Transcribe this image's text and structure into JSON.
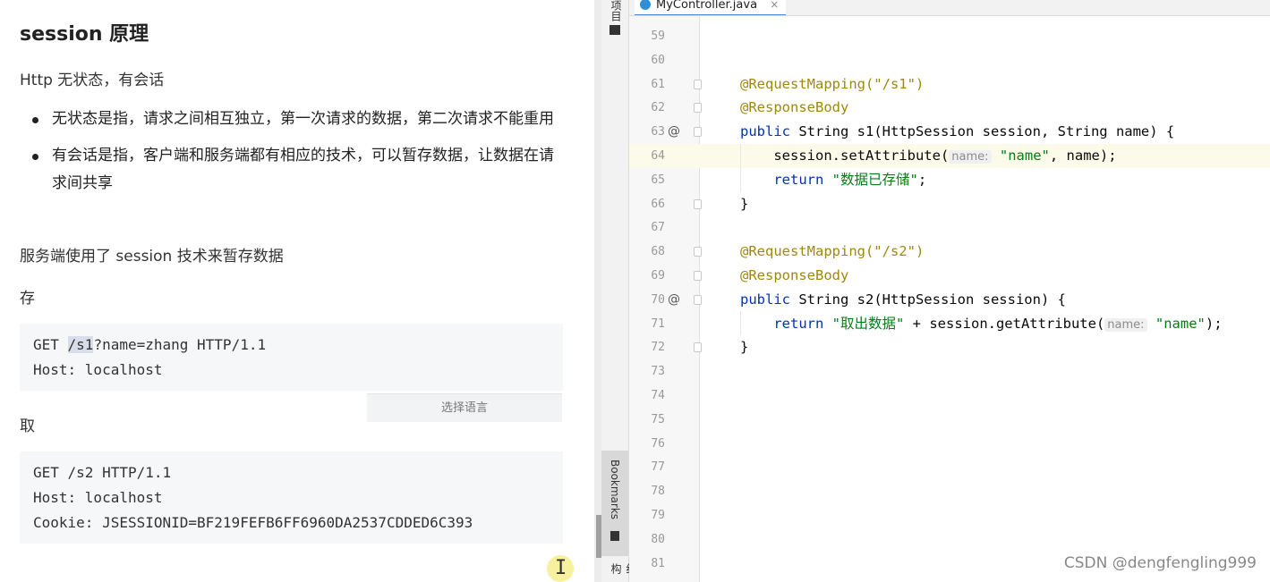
{
  "doc": {
    "title": "session 原理",
    "intro": "Http 无状态，有会话",
    "bullets": [
      "无状态是指，请求之间相互独立，第一次请求的数据，第二次请求不能重用",
      "有会话是指，客户端和服务端都有相应的技术，可以暂存数据，让数据在请求间共享"
    ],
    "server_note": "服务端使用了 session 技术来暂存数据",
    "store_label": "存",
    "store_code": [
      "GET ",
      "/s1",
      "?name=zhang HTTP/1.1",
      "Host: localhost"
    ],
    "lang_select": "选择语言",
    "fetch_label": "取",
    "fetch_code": [
      "GET /s2 HTTP/1.1",
      "Host: localhost",
      "Cookie: JSESSIONID=BF219FEFB6FF6960DA2537CDDED6C393"
    ]
  },
  "tool_strip": {
    "project_label": "项目",
    "bookmarks_label": "Bookmarks",
    "structure_label": "结构"
  },
  "editor": {
    "tab_title": "MyController.java",
    "tab_close": "×",
    "line_numbers": [
      "59",
      "60",
      "61",
      "62",
      "63",
      "64",
      "65",
      "66",
      "67",
      "68",
      "69",
      "70",
      "71",
      "72",
      "73",
      "74",
      "75",
      "76",
      "77",
      "78",
      "79",
      "80",
      "81"
    ],
    "gutter_marks": {
      "63": "@",
      "70": "@"
    },
    "code": {
      "l61": "@RequestMapping(\"/s1\")",
      "l62": "@ResponseBody",
      "l63_kw": "public",
      "l63_rest": " String s1(HttpSession session, String name) {",
      "l64_a": "    session.setAttribute(",
      "l64_hint": "name:",
      "l64_str": "\"name\"",
      "l64_b": ", name);",
      "l65_kw": "    return",
      "l65_str": " \"数据已存储\"",
      "l65_b": ";",
      "l66": "}",
      "l68": "@RequestMapping(\"/s2\")",
      "l69": "@ResponseBody",
      "l70_kw": "public",
      "l70_rest": " String s2(HttpSession session) {",
      "l71_kw": "    return",
      "l71_str": " \"取出数据\"",
      "l71_a": " + session.getAttribute(",
      "l71_hint": "name:",
      "l71_str2": "\"name\"",
      "l71_b": ");",
      "l72": "}"
    }
  },
  "watermark": "CSDN @dengfengling999",
  "colors": {
    "keyword": "#0033b3",
    "annotation": "#9e880d",
    "string": "#067d17",
    "tab_underline": "#4a86e8"
  }
}
